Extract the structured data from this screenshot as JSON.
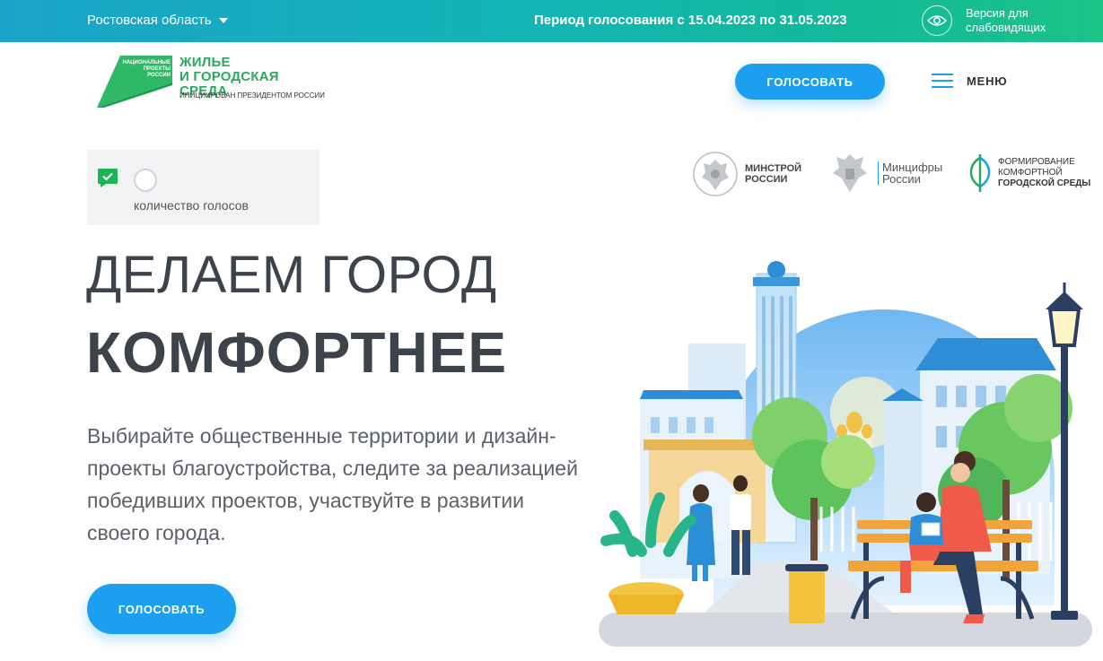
{
  "topbar": {
    "region": "Ростовская область",
    "period": "Период голосования с 15.04.2023 по 31.05.2023",
    "vision_line1": "Версия для",
    "vision_line2": "слабовидящих"
  },
  "logo": {
    "title_line1": "ЖИЛЬЕ",
    "title_line2": "И ГОРОДСКАЯ СРЕДА",
    "subtitle": "ИНИЦИИРОВАН ПРЕЗИДЕНТОМ РОССИИ",
    "badge_line1": "НАЦИОНАЛЬНЫЕ",
    "badge_line2": "ПРОЕКТЫ",
    "badge_line3": "РОССИИ"
  },
  "header": {
    "vote_button": "ГОЛОСОВАТЬ",
    "menu_label": "МЕНЮ"
  },
  "counter": {
    "label": "количество голосов"
  },
  "partners": {
    "minstroy_line1": "МИНСТРОЙ",
    "minstroy_line2": "РОССИИ",
    "mincifry_line1": "Минцифры",
    "mincifry_line2": "России",
    "comfort_line1": "ФОРМИРОВАНИЕ",
    "comfort_line2": "КОМФОРТНОЙ",
    "comfort_line3": "ГОРОДСКОЙ СРЕДЫ"
  },
  "hero": {
    "title_line1": "ДЕЛАЕМ ГОРОД",
    "title_line2": "КОМФОРТНЕЕ",
    "description": "Выбирайте общественные территории и дизайн-проекты благоустройства, следите за реализацией победивших проектов, участвуйте в развитии своего города.",
    "vote_button": "ГОЛОСОВАТЬ"
  },
  "colors": {
    "accent": "#1d9ff0",
    "brand_green": "#2aa85f",
    "topbar_start": "#1aa3c9",
    "topbar_end": "#1cc387"
  },
  "icons": {
    "region": "chevron-down-icon",
    "vision": "eye-icon",
    "menu": "hamburger-icon",
    "counter_check": "checkbox-icon",
    "counter_ring": "progress-ring-icon"
  }
}
